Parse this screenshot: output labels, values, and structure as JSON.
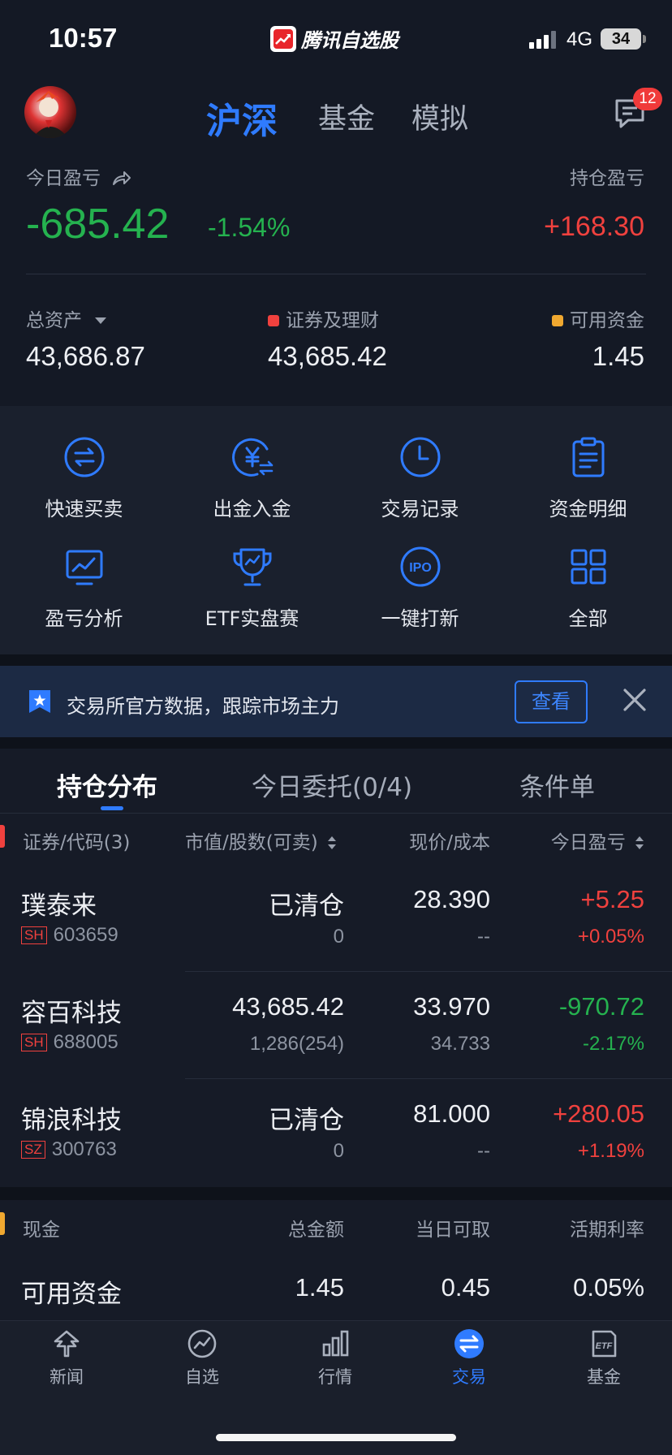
{
  "status_bar": {
    "time": "10:57",
    "app_name": "腾讯自选股",
    "network": "4G",
    "battery": "34"
  },
  "header": {
    "tabs": [
      {
        "label": "沪深",
        "active": true
      },
      {
        "label": "基金",
        "active": false
      },
      {
        "label": "模拟",
        "active": false
      }
    ],
    "message_badge": "12"
  },
  "summary": {
    "today_pnl_label": "今日盈亏",
    "today_pnl": "-685.42",
    "today_pnl_pct": "-1.54%",
    "holding_pnl_label": "持仓盈亏",
    "holding_pnl": "+168.30",
    "total_assets_label": "总资产",
    "total_assets": "43,686.87",
    "securities_label": "证券及理财",
    "securities": "43,685.42",
    "available_label": "可用资金",
    "available": "1.45",
    "securities_dot_color": "#f0413e",
    "available_dot_color": "#f0a830"
  },
  "shortcuts": [
    {
      "label": "快速买卖",
      "icon": "swap-circle-icon"
    },
    {
      "label": "出金入金",
      "icon": "yuan-transfer-icon"
    },
    {
      "label": "交易记录",
      "icon": "clock-icon"
    },
    {
      "label": "资金明细",
      "icon": "clipboard-icon"
    },
    {
      "label": "盈亏分析",
      "icon": "chart-monitor-icon"
    },
    {
      "label": "ETF实盘赛",
      "icon": "trophy-icon"
    },
    {
      "label": "一键打新",
      "icon": "ipo-icon"
    },
    {
      "label": "全部",
      "icon": "grid-icon"
    }
  ],
  "banner": {
    "text": "交易所官方数据，跟踪市场主力",
    "button": "查看"
  },
  "holdings_tabs": [
    {
      "label": "持仓分布",
      "active": true
    },
    {
      "label": "今日委托(0/4)",
      "active": false
    },
    {
      "label": "条件单",
      "active": false
    }
  ],
  "holdings_columns": {
    "security": "证券/代码(3)",
    "market_value": "市值/股数(可卖)",
    "price": "现价/成本",
    "today_pnl": "今日盈亏"
  },
  "holdings": [
    {
      "name": "璞泰来",
      "market": "SH",
      "code": "603659",
      "value": "已清仓",
      "shares": "0",
      "price": "28.390",
      "cost": "--",
      "pnl": "+5.25",
      "pnl_pct": "+0.05%",
      "direction": "up"
    },
    {
      "name": "容百科技",
      "market": "SH",
      "code": "688005",
      "value": "43,685.42",
      "shares": "1,286(254)",
      "price": "33.970",
      "cost": "34.733",
      "pnl": "-970.72",
      "pnl_pct": "-2.17%",
      "direction": "down"
    },
    {
      "name": "锦浪科技",
      "market": "SZ",
      "code": "300763",
      "value": "已清仓",
      "shares": "0",
      "price": "81.000",
      "cost": "--",
      "pnl": "+280.05",
      "pnl_pct": "+1.19%",
      "direction": "up"
    }
  ],
  "cash": {
    "header": "现金",
    "col_total": "总金额",
    "col_today": "当日可取",
    "col_rate": "活期利率",
    "row_label": "可用资金",
    "total": "1.45",
    "today": "0.45",
    "rate": "0.05%"
  },
  "bottom_nav": [
    {
      "label": "新闻",
      "icon": "news-icon",
      "active": false
    },
    {
      "label": "自选",
      "icon": "watchlist-icon",
      "active": false
    },
    {
      "label": "行情",
      "icon": "market-icon",
      "active": false
    },
    {
      "label": "交易",
      "icon": "trade-icon",
      "active": true
    },
    {
      "label": "基金",
      "icon": "etf-icon",
      "active": false
    }
  ],
  "colors": {
    "accent": "#2f7bff",
    "up": "#f0413e",
    "down": "#25b24f",
    "background": "#141925"
  }
}
